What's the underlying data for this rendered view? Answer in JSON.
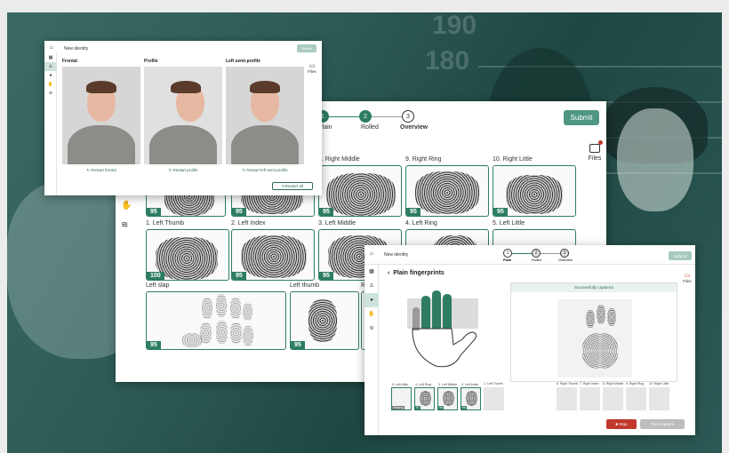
{
  "w1": {
    "breadcrumb": "New identity",
    "submit": "Submit",
    "files": "Files",
    "sidebar_icons": [
      "grid-icon",
      "user-icon",
      "circle-icon",
      "hand-icon",
      "fingerprint-icon"
    ],
    "columns": [
      {
        "label": "Frontal",
        "restart": "Restart frontal"
      },
      {
        "label": "Profile",
        "restart": "Restart profile"
      },
      {
        "label": "Left semi-profile",
        "restart": "Restart left semi-profile"
      }
    ],
    "restart_all": "Restart all"
  },
  "w2": {
    "steps": [
      {
        "num": "1",
        "label": "Plain",
        "state": "done"
      },
      {
        "num": "2",
        "label": "Rolled",
        "state": "done"
      },
      {
        "num": "3",
        "label": "Overview",
        "state": "current"
      }
    ],
    "submit": "Submit",
    "files": "Files",
    "row1": [
      {
        "label": "",
        "score": "95"
      },
      {
        "label": "",
        "score": "95"
      },
      {
        "label": "8. Right Middle",
        "score": "95"
      },
      {
        "label": "9. Right Ring",
        "score": "95"
      },
      {
        "label": "10. Right Little",
        "score": "95"
      }
    ],
    "row2": [
      {
        "label": "1. Left Thumb",
        "score": "100"
      },
      {
        "label": "2. Left Index",
        "score": "95"
      },
      {
        "label": "3. Left Middle",
        "score": "95"
      },
      {
        "label": "4. Left Ring",
        "score": ""
      },
      {
        "label": "5. Left Little",
        "score": ""
      }
    ],
    "row3": [
      {
        "label": "Left slap",
        "score": "95"
      },
      {
        "label": "Left thumb",
        "score": "95"
      },
      {
        "label": "R",
        "score": ""
      }
    ]
  },
  "w3": {
    "breadcrumb": "New identity",
    "submit": "Submit",
    "files": "Files",
    "steps": [
      {
        "num": "1",
        "label": "Plain"
      },
      {
        "num": "2",
        "label": "Rolled"
      },
      {
        "num": "3",
        "label": "Overview"
      }
    ],
    "title": "Plain fingerprints",
    "captured": "Successfully captured",
    "left_slots": [
      {
        "label": "5. Left Little",
        "badge": "Missing"
      },
      {
        "label": "4. Left Ring",
        "badge": "97"
      },
      {
        "label": "3. Left Middle",
        "badge": "99"
      },
      {
        "label": "2. Left Index",
        "badge": "96"
      },
      {
        "label": "1. Left Thumb",
        "badge": ""
      }
    ],
    "right_slots": [
      {
        "label": "6. Right Thumb"
      },
      {
        "label": "7. Right Index"
      },
      {
        "label": "8. Right Middle"
      },
      {
        "label": "9. Right Ring"
      },
      {
        "label": "10. Right Little"
      }
    ],
    "stop": "Stop",
    "point_capture": "Point capture"
  },
  "background": {
    "numbers": [
      "180",
      "190"
    ]
  },
  "colors": {
    "accent": "#2e7d62",
    "bg": "#2d5a55",
    "stop": "#c0392b"
  }
}
